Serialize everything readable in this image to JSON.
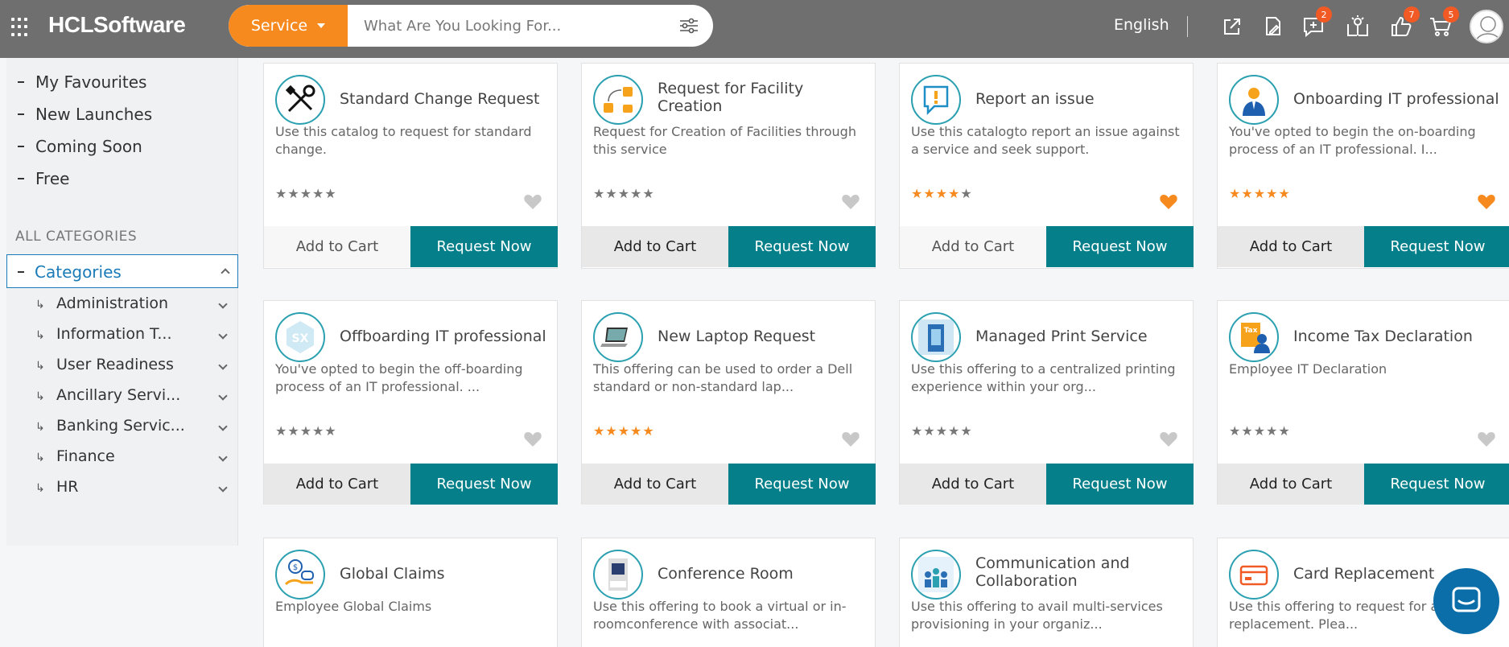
{
  "header": {
    "logo": "HCLSoftware",
    "service_label": "Service",
    "search_placeholder": "What Are You Looking For...",
    "language": "English",
    "badges": {
      "new_request": "2",
      "likes": "7",
      "cart": "5"
    }
  },
  "sidebar": {
    "links": [
      "My Favourites",
      "New Launches",
      "Coming Soon",
      "Free"
    ],
    "all_categories": "ALL CATEGORIES",
    "categories_label": "Categories",
    "subcategories": [
      "Administration",
      "Information T...",
      "User Readiness",
      "Ancillary Servi...",
      "Banking Servic...",
      "Finance",
      "HR"
    ]
  },
  "cards": [
    {
      "title": "Standard Change Request",
      "desc": "Use this catalog to request for standard change.",
      "rating": 0,
      "fav": false,
      "icon": "tools-icon",
      "cart": "Add to Cart",
      "request": "Request Now"
    },
    {
      "title": "Request for Facility Creation",
      "desc": "Request for Creation of Facilities through this service",
      "rating": 0,
      "fav": false,
      "icon": "facility-icon",
      "cart": "Add to Cart",
      "request": "Request Now"
    },
    {
      "title": "Report an issue",
      "desc": "Use this catalogto report an issue against a service and seek support.",
      "rating": 4,
      "fav": true,
      "icon": "issue-icon",
      "cart": "Add to Cart",
      "request": "Request Now"
    },
    {
      "title": "Onboarding IT professional",
      "desc": "You've opted to begin the on-boarding process of an IT professional. I...",
      "rating": 5,
      "fav": true,
      "icon": "onboarding-icon",
      "cart": "Add to Cart",
      "request": "Request Now"
    },
    {
      "title": "Offboarding IT professional",
      "desc": "You've opted to begin the off-boarding process of an IT professional. ...",
      "rating": 0,
      "fav": false,
      "icon": "offboarding-icon",
      "cart": "Add to Cart",
      "request": "Request Now"
    },
    {
      "title": "New Laptop Request",
      "desc": "This offering can be used to order a Dell standard or non-standard lap...",
      "rating": 5,
      "fav": false,
      "icon": "laptop-icon",
      "cart": "Add to Cart",
      "request": "Request Now"
    },
    {
      "title": "Managed Print Service",
      "desc": "Use this offering to a centralized printing experience within your org...",
      "rating": 0,
      "fav": false,
      "icon": "print-icon",
      "cart": "Add to Cart",
      "request": "Request Now"
    },
    {
      "title": "Income Tax Declaration",
      "desc": "Employee IT Declaration",
      "rating": 0,
      "fav": false,
      "icon": "tax-icon",
      "cart": "Add to Cart",
      "request": "Request Now"
    },
    {
      "title": "Global Claims",
      "desc": "Employee Global Claims",
      "icon": "claims-icon"
    },
    {
      "title": "Conference Room",
      "desc": "Use this offering to book a virtual or in-roomconference with associat...",
      "icon": "conference-icon"
    },
    {
      "title": "Communication and Collaboration",
      "desc": "Use this offering to avail multi-services provisioning in your organiz...",
      "icon": "collaboration-icon"
    },
    {
      "title": "Card Replacement",
      "desc": "Use this offering to request for a c... card replacement. Plea...",
      "icon": "card-icon"
    }
  ]
}
